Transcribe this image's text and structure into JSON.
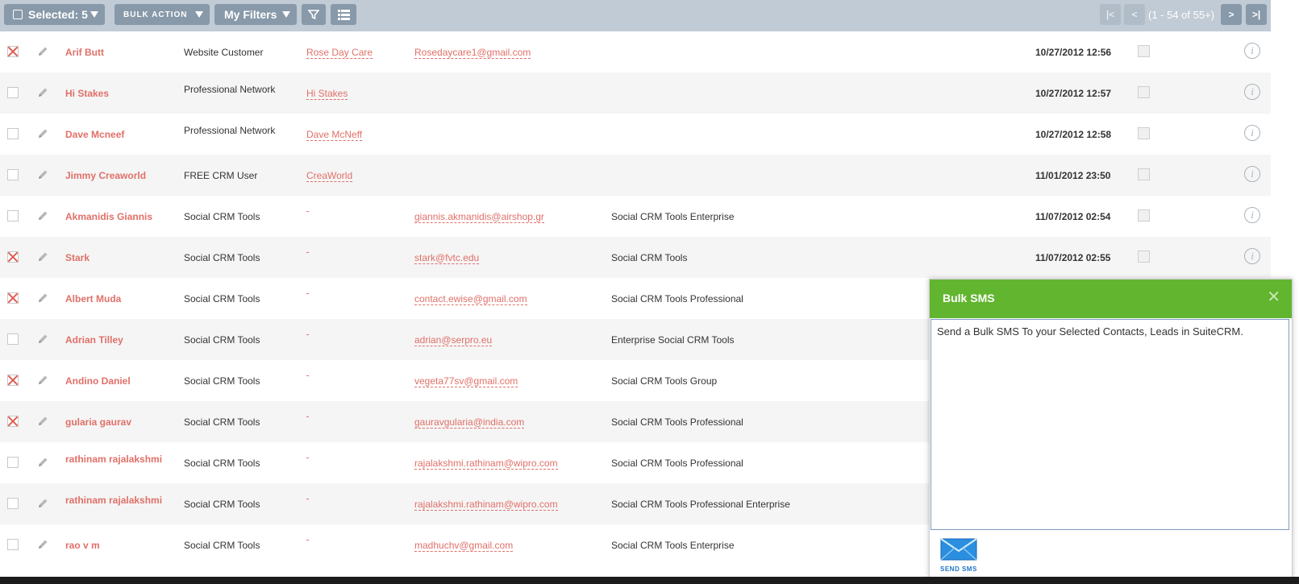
{
  "toolbar": {
    "selected_label": "Selected: 5",
    "bulk_action_label": "BULK ACTION",
    "filters_label": "My Filters",
    "pager_first": "|<",
    "pager_prev": "<",
    "pager_text": "(1 - 54 of 55+)",
    "pager_next": ">",
    "pager_last": ">|"
  },
  "rows": [
    {
      "checked": true,
      "name": "Arif Butt",
      "lead_source": "Website Customer",
      "account": "Rose Day Care",
      "email": "Rosedaycare1@gmail.com",
      "campaign": "",
      "date": "10/27/2012 12:56"
    },
    {
      "checked": false,
      "name": "Hi Stakes",
      "lead_source": "Professional Network",
      "account": "Hi Stakes",
      "email": "",
      "campaign": "",
      "date": "10/27/2012 12:57"
    },
    {
      "checked": false,
      "name": "Dave Mcneef",
      "lead_source": "Professional Network",
      "account": "Dave McNeff",
      "email": "",
      "campaign": "",
      "date": "10/27/2012 12:58"
    },
    {
      "checked": false,
      "name": "Jimmy Creaworld",
      "lead_source": "FREE CRM User",
      "account": "CreaWorld",
      "email": "",
      "campaign": "",
      "date": "11/01/2012 23:50"
    },
    {
      "checked": false,
      "name": "Akmanidis Giannis",
      "lead_source": "Social CRM Tools",
      "account": "",
      "email": "giannis.akmanidis@airshop.gr",
      "campaign": "Social CRM Tools Enterprise",
      "date": "11/07/2012 02:54"
    },
    {
      "checked": true,
      "name": "Stark",
      "lead_source": "Social CRM Tools",
      "account": "",
      "email": "stark@fvtc.edu",
      "campaign": "Social CRM Tools",
      "date": "11/07/2012 02:55"
    },
    {
      "checked": true,
      "name": "Albert Muda",
      "lead_source": "Social CRM Tools",
      "account": "",
      "email": "contact.ewise@gmail.com",
      "campaign": "Social CRM Tools Professional",
      "date": ""
    },
    {
      "checked": false,
      "name": "Adrian Tilley",
      "lead_source": "Social CRM Tools",
      "account": "",
      "email": "adrian@serpro.eu",
      "campaign": "Enterprise Social CRM Tools",
      "date": ""
    },
    {
      "checked": true,
      "name": "Andino Daniel",
      "lead_source": "Social CRM Tools",
      "account": "",
      "email": "vegeta77sv@gmail.com",
      "campaign": "Social CRM Tools Group",
      "date": ""
    },
    {
      "checked": true,
      "name": "gularia gaurav",
      "lead_source": "Social CRM Tools",
      "account": "",
      "email": "gauravgularia@india.com",
      "campaign": "Social CRM Tools Professional",
      "date": ""
    },
    {
      "checked": false,
      "name": "rathinam rajalakshmi",
      "lead_source": "Social CRM Tools",
      "account": "",
      "email": "rajalakshmi.rathinam@wipro.com",
      "campaign": "Social CRM Tools Professional",
      "date": ""
    },
    {
      "checked": false,
      "name": "rathinam rajalakshmi",
      "lead_source": "Social CRM Tools",
      "account": "",
      "email": "rajalakshmi.rathinam@wipro.com",
      "campaign": "Social CRM Tools Professional Enterprise",
      "date": ""
    },
    {
      "checked": false,
      "name": "rao v m",
      "lead_source": "Social CRM Tools",
      "account": "",
      "email": "madhuchv@gmail.com",
      "campaign": "Social CRM Tools Enterprise",
      "date": ""
    }
  ],
  "dialog": {
    "title": "Bulk SMS",
    "close": "✕",
    "message": "Send a Bulk SMS To your Selected Contacts, Leads in SuiteCRM.",
    "send_label": "SEND SMS"
  },
  "colors": {
    "toolbar_bg": "#c1cbd5",
    "button_bg": "#8899a9",
    "link": "#e07068",
    "dialog_header": "#61b52f"
  }
}
